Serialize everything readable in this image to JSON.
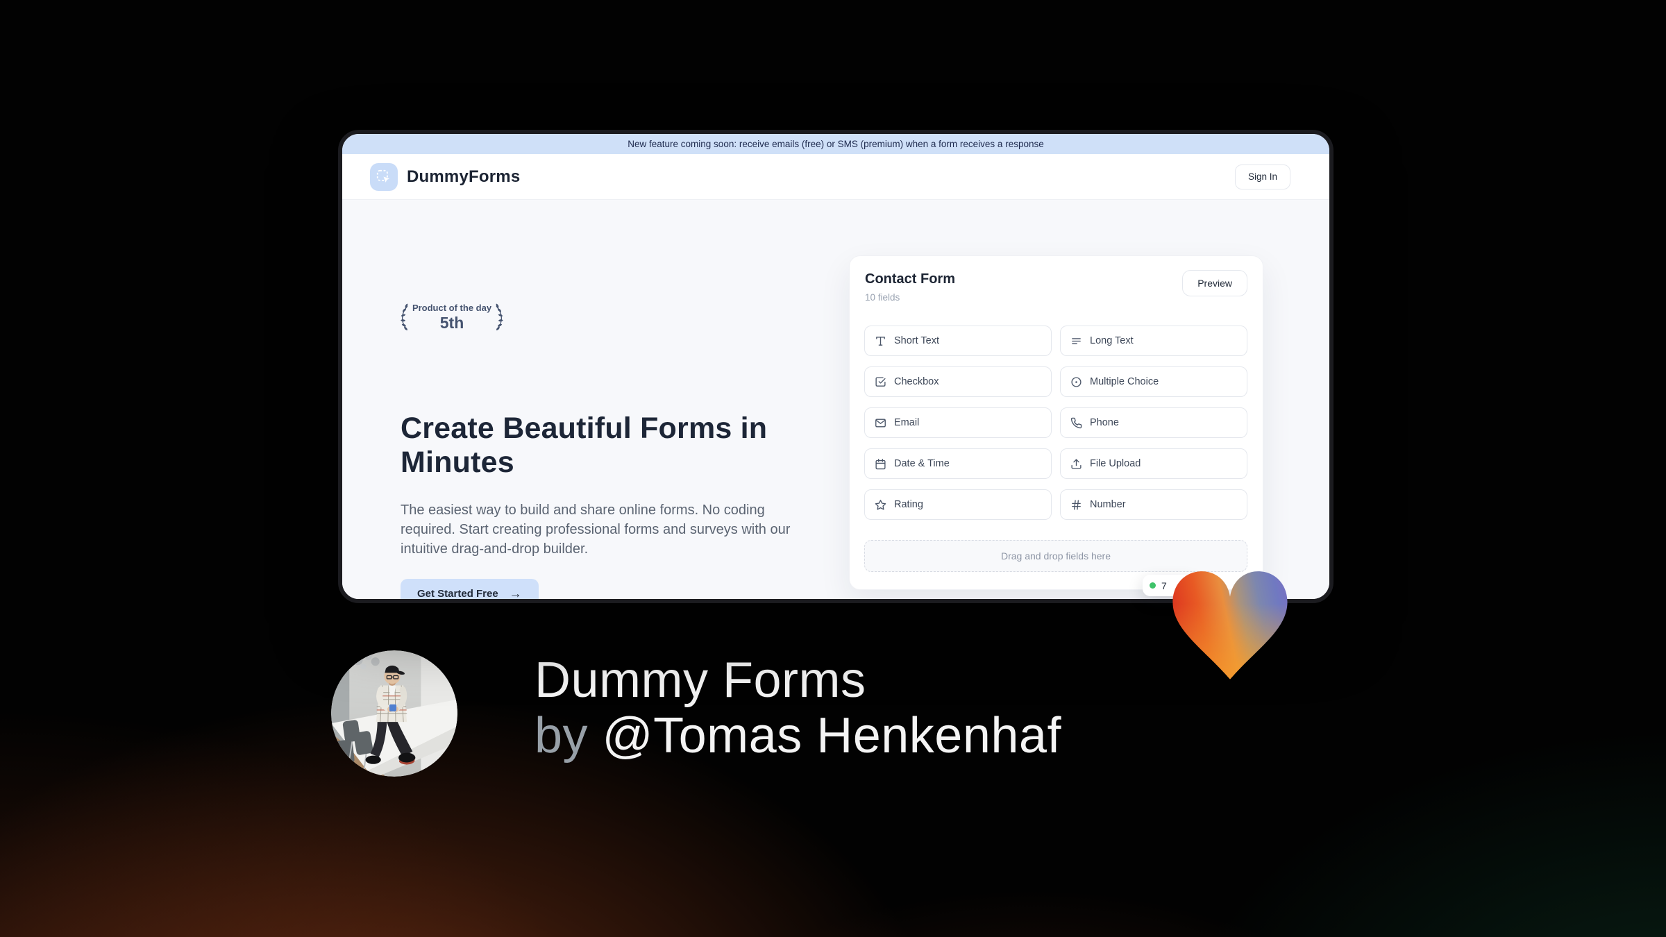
{
  "banner": {
    "text": "New feature coming soon: receive emails (free) or SMS (premium) when a form receives a response"
  },
  "header": {
    "brand": "DummyForms",
    "sign_in_label": "Sign In"
  },
  "hero": {
    "badge_line1": "Product of the day",
    "badge_line2": "5th",
    "title": "Create Beautiful Forms in Minutes",
    "description": "The easiest way to build and share online forms. No coding required. Start creating professional forms and surveys with our intuitive drag-and-drop builder.",
    "cta_label": "Get Started Free",
    "cta_arrow": "→"
  },
  "form_builder": {
    "title": "Contact Form",
    "subtitle": "10 fields",
    "preview_label": "Preview",
    "fields": [
      {
        "label": "Short Text",
        "icon": "text-icon"
      },
      {
        "label": "Long Text",
        "icon": "lines-icon"
      },
      {
        "label": "Checkbox",
        "icon": "checkbox-icon"
      },
      {
        "label": "Multiple Choice",
        "icon": "radio-icon"
      },
      {
        "label": "Email",
        "icon": "envelope-icon"
      },
      {
        "label": "Phone",
        "icon": "phone-icon"
      },
      {
        "label": "Date & Time",
        "icon": "calendar-icon"
      },
      {
        "label": "File Upload",
        "icon": "upload-icon"
      },
      {
        "label": "Rating",
        "icon": "star-icon"
      },
      {
        "label": "Number",
        "icon": "hash-icon"
      }
    ],
    "dropzone_text": "Drag and drop fields here",
    "status_badge_text": "7"
  },
  "credit": {
    "line1": "Dummy Forms",
    "by": "by ",
    "author": "@Tomas Henkenhaf"
  },
  "colors": {
    "banner_bg": "#cfe0f8",
    "accent_blue": "#c9dcf8",
    "heading": "#1d2637",
    "body_text": "#5b6472",
    "muted": "#98a1b0",
    "green_dot": "#3fc36a",
    "heart_red": "#e03a20",
    "heart_orange": "#f5a02c",
    "heart_blue": "#7276c0"
  }
}
